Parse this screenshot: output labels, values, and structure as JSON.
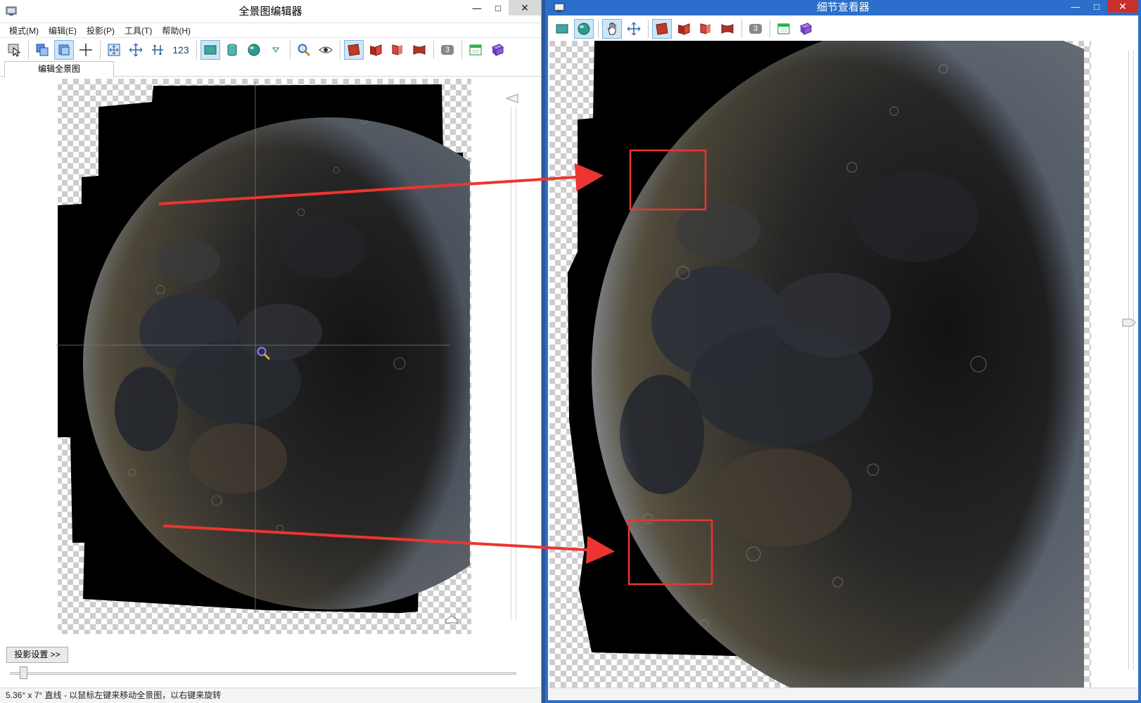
{
  "left_window": {
    "title": "全景图编辑器",
    "menu": [
      "模式(M)",
      "编辑(E)",
      "投影(P)",
      "工具(T)",
      "帮助(H)"
    ],
    "toolbar_text": "123",
    "toolbar_badge": "3",
    "tab_label": "编辑全景图",
    "projection_button": "投影设置 >>",
    "status_text": "5.36° x 7° 直线 - 以鼠标左键来移动全景图，以右键来旋转"
  },
  "right_window": {
    "title": "细节查看器",
    "toolbar_badge": "3"
  },
  "window_controls": {
    "minimize": "—",
    "maximize": "□",
    "close": "✕"
  },
  "colors": {
    "accent_blue": "#2b6fca",
    "annotation_red": "#ec3530",
    "toolbar_active": "#cde6f7",
    "moon_mare": "#2b2f36",
    "moon_highlands": "#5a5446"
  }
}
